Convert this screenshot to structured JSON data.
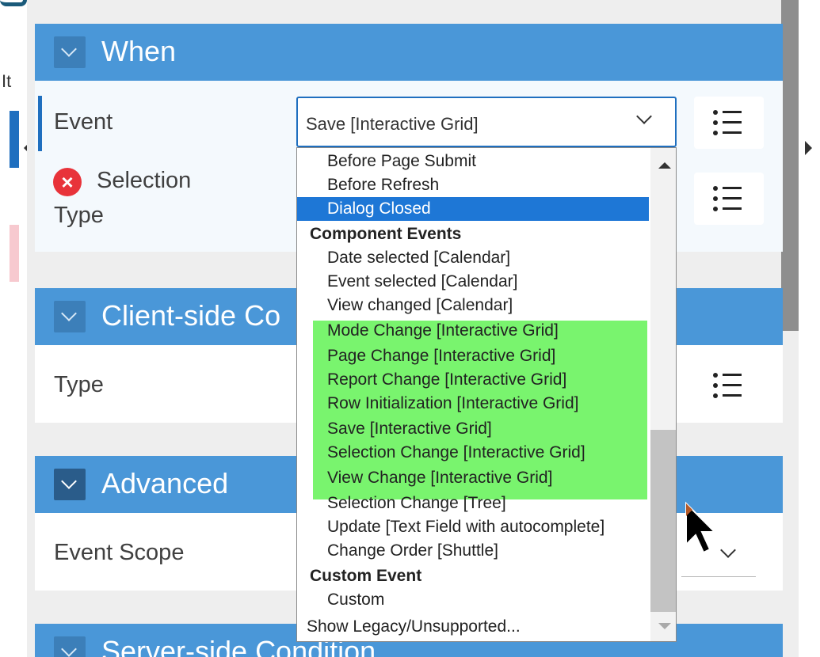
{
  "sections": {
    "when": {
      "title": "When",
      "event_label": "Event",
      "event_value": "Save [Interactive Grid]",
      "selection_type_label_1": "Selection",
      "selection_type_label_2": "Type"
    },
    "client_side": {
      "title": "Client-side Co",
      "type_label": "Type"
    },
    "advanced": {
      "title": "Advanced",
      "event_scope_label": "Event Scope"
    },
    "server_side": {
      "title": "Server-side Condition"
    }
  },
  "dropdown": {
    "items": [
      {
        "label": "Before Page Submit",
        "kind": "indent"
      },
      {
        "label": "Before Refresh",
        "kind": "indent"
      },
      {
        "label": "Dialog Closed",
        "kind": "indent",
        "selected": true
      },
      {
        "label": "Component Events",
        "kind": "group"
      },
      {
        "label": "Date selected [Calendar]",
        "kind": "indent"
      },
      {
        "label": "Event selected [Calendar]",
        "kind": "indent"
      },
      {
        "label": "View changed [Calendar]",
        "kind": "indent"
      },
      {
        "label": "Mode Change [Interactive Grid]",
        "kind": "indent",
        "highlighted": true
      },
      {
        "label": "Page Change [Interactive Grid]",
        "kind": "indent",
        "highlighted": true
      },
      {
        "label": "Report Change [Interactive Grid]",
        "kind": "indent",
        "highlighted": true
      },
      {
        "label": "Row Initialization [Interactive Grid]",
        "kind": "indent",
        "highlighted": true
      },
      {
        "label": "Save [Interactive Grid]",
        "kind": "indent",
        "highlighted": true
      },
      {
        "label": "Selection Change [Interactive Grid]",
        "kind": "indent",
        "highlighted": true
      },
      {
        "label": "View Change [Interactive Grid]",
        "kind": "indent",
        "highlighted": true
      },
      {
        "label": "Selection Change [Tree]",
        "kind": "indent"
      },
      {
        "label": "Update [Text Field with autocomplete]",
        "kind": "indent"
      },
      {
        "label": "Change Order [Shuttle]",
        "kind": "indent"
      },
      {
        "label": "Custom Event",
        "kind": "group"
      },
      {
        "label": "Custom",
        "kind": "indent"
      },
      {
        "label": "Show Legacy/Unsupported...",
        "kind": "footer"
      }
    ],
    "highlight_color": "#79f46e",
    "selected_color": "#1e77d6"
  },
  "left_edge": {
    "partial_char": "It"
  },
  "colors": {
    "header_blue": "#4a97d8",
    "accent_blue": "#1f6fbf",
    "error_red": "#e8333a"
  },
  "icons": {
    "list": "list-icon",
    "error": "error-icon",
    "collapse": "chevron-down-icon"
  }
}
